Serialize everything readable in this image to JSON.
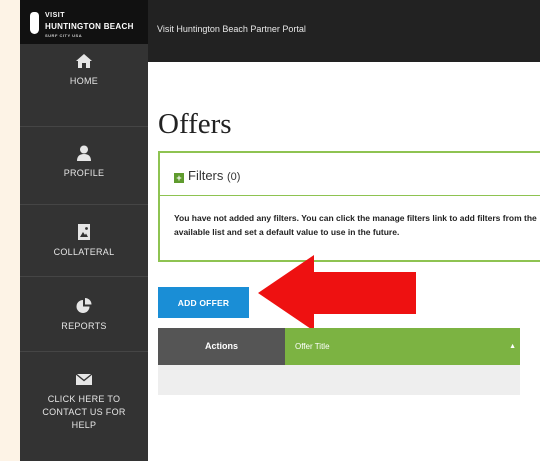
{
  "logo": {
    "line1": "VISIT",
    "line2": "HUNTINGTON BEACH",
    "tagline": "SURF CITY USA"
  },
  "topbar": {
    "portal_title": "Visit Huntington Beach Partner Portal"
  },
  "sidebar": {
    "items": [
      {
        "label": "HOME",
        "icon": "home-icon"
      },
      {
        "label": "PROFILE",
        "icon": "user-icon"
      },
      {
        "label": "COLLATERAL",
        "icon": "image-file-icon"
      },
      {
        "label": "REPORTS",
        "icon": "pie-chart-icon"
      },
      {
        "label": "CLICK HERE TO CONTACT US FOR HELP",
        "icon": "envelope-icon"
      }
    ]
  },
  "main": {
    "page_title": "Offers",
    "filters": {
      "title": "Filters",
      "count": "(0)",
      "message": "You have not added any filters. You can click the manage filters link to add filters from the available list and set a default value to use in the future."
    },
    "add_offer_label": "ADD OFFER",
    "table": {
      "columns": [
        "Actions",
        "Offer Title"
      ]
    }
  },
  "colors": {
    "sidebar": "#333333",
    "topbar": "#222222",
    "accent_green": "#7cb342",
    "button_blue": "#1a8ed6",
    "annotation_arrow": "#ee1111"
  }
}
